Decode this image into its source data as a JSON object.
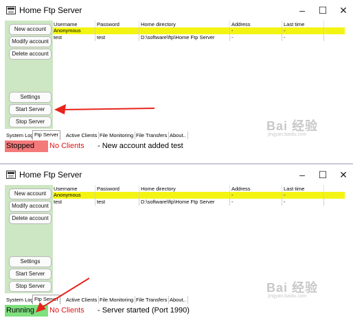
{
  "windows": [
    {
      "title": "Home Ftp Server",
      "sidebar": {
        "buttons": [
          "New account",
          "Modify account",
          "Delete account",
          "Settings",
          "Start Server",
          "Stop Server"
        ]
      },
      "table": {
        "columns": [
          "Username",
          "Password",
          "Home directory",
          "Address",
          "Last time"
        ],
        "rows": [
          [
            "Anonymous",
            "",
            "",
            "-",
            "-"
          ],
          [
            "test",
            "test",
            "D:\\software\\ftp\\Home Ftp Server",
            "-",
            "-"
          ]
        ]
      },
      "tabs": [
        "System Log",
        "Ftp Server",
        "Active Clients",
        "File Monitoring",
        "File Transfers",
        "About.."
      ],
      "active_tab": "Ftp Server",
      "status": {
        "state": "Stopped",
        "clients": "No Clients",
        "message": "- New account added test"
      },
      "colors": {
        "state_bg": "#f47a7a"
      }
    },
    {
      "title": "Home Ftp Server",
      "sidebar": {
        "buttons": [
          "New account",
          "Modify account",
          "Delete account",
          "Settings",
          "Start Server",
          "Stop Server"
        ]
      },
      "table": {
        "columns": [
          "Username",
          "Password",
          "Home directory",
          "Address",
          "Last time"
        ],
        "rows": [
          [
            "Anonymous",
            "",
            "",
            "-",
            "-"
          ],
          [
            "test",
            "test",
            "D:\\software\\ftp\\Home Ftp Server",
            "-",
            "-"
          ]
        ]
      },
      "tabs": [
        "System Log",
        "Ftp Server",
        "Active Clients",
        "File Monitoring",
        "File Transfers",
        "About.."
      ],
      "active_tab": "Ftp Server",
      "status": {
        "state": "Running",
        "clients": "No Clients",
        "message": "- Server started (Port 1990)"
      },
      "colors": {
        "state_bg": "#7ee07e"
      }
    }
  ],
  "window_controls": {
    "minimize": "–",
    "maximize": "☐",
    "close": "✕"
  },
  "watermark": {
    "brand": "Bai",
    "suffix": "经验",
    "sub": "jingyan.baidu.com"
  },
  "colors": {
    "sidebar_bg": "#cde6c3",
    "selected_row": "#f4f413",
    "clients_text": "#e01414",
    "annotation_arrow": "#e8231b"
  }
}
